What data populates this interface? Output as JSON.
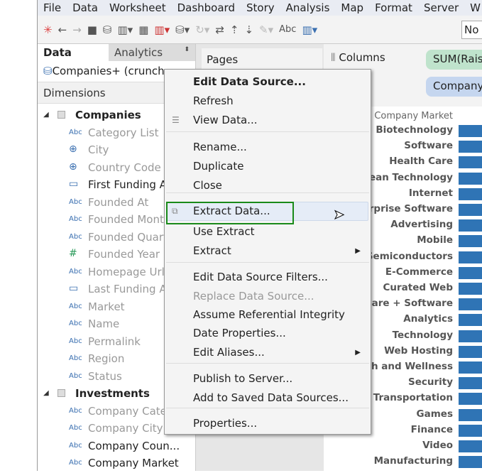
{
  "menubar": [
    "File",
    "Data",
    "Worksheet",
    "Dashboard",
    "Story",
    "Analysis",
    "Map",
    "Format",
    "Server",
    "W"
  ],
  "toolbar": {
    "abc_label": "Abc",
    "dropdown_value": "No"
  },
  "side": {
    "tab_data": "Data",
    "tab_analytics": "Analytics",
    "datasource": "Companies+ (crunch",
    "dimensions_label": "Dimensions",
    "fields": [
      {
        "type": "group",
        "label": "Companies"
      },
      {
        "type": "abc",
        "label": "Category List"
      },
      {
        "type": "geo",
        "label": "City"
      },
      {
        "type": "geo",
        "label": "Country Code"
      },
      {
        "type": "date",
        "label": "First Funding A",
        "dark": true
      },
      {
        "type": "abc",
        "label": "Founded At"
      },
      {
        "type": "abc",
        "label": "Founded Mont"
      },
      {
        "type": "abc",
        "label": "Founded Quart"
      },
      {
        "type": "num",
        "label": "Founded Year"
      },
      {
        "type": "abc",
        "label": "Homepage Url"
      },
      {
        "type": "date",
        "label": "Last Funding A"
      },
      {
        "type": "abc",
        "label": "Market"
      },
      {
        "type": "abc",
        "label": "Name"
      },
      {
        "type": "abc",
        "label": "Permalink"
      },
      {
        "type": "abc",
        "label": "Region"
      },
      {
        "type": "abc",
        "label": "Status"
      },
      {
        "type": "group",
        "label": "Investments"
      },
      {
        "type": "abc",
        "label": "Company Cate"
      },
      {
        "type": "abc",
        "label": "Company City"
      },
      {
        "type": "abc",
        "label": "Company Coun...",
        "dark": true
      },
      {
        "type": "abc",
        "label": "Company Market",
        "dark": true
      }
    ]
  },
  "shelves": {
    "pages": "Pages",
    "columns": "Columns",
    "columns_pill": "SUM(Raise",
    "rows_pill": "Company"
  },
  "chart": {
    "header": "Company Market",
    "categories": [
      "Biotechnology",
      "Software",
      "Health Care",
      "Clean Technology",
      "Internet",
      "Enterprise Software",
      "Advertising",
      "Mobile",
      "Semiconductors",
      "E-Commerce",
      "Curated Web",
      "Hardware + Software",
      "Analytics",
      "Technology",
      "Web Hosting",
      "Health and Wellness",
      "Security",
      "Transportation",
      "Games",
      "Finance",
      "Video",
      "Manufacturing"
    ],
    "bar_color": "#2f74b5"
  },
  "context_menu": {
    "items": [
      {
        "label": "Edit Data Source...",
        "bold": true
      },
      {
        "label": "Refresh"
      },
      {
        "label": "View Data...",
        "icon": "table-icon"
      },
      {
        "label": "Rename..."
      },
      {
        "label": "Duplicate"
      },
      {
        "label": "Close"
      },
      {
        "label": "Extract Data...",
        "icon": "extract-icon",
        "highlighted": true
      },
      {
        "label": "Use Extract"
      },
      {
        "label": "Extract",
        "submenu": true
      },
      {
        "label": "Edit Data Source Filters..."
      },
      {
        "label": "Replace Data Source...",
        "disabled": true
      },
      {
        "label": "Assume Referential Integrity"
      },
      {
        "label": "Date Properties..."
      },
      {
        "label": "Edit Aliases...",
        "submenu": true
      },
      {
        "label": "Publish to Server..."
      },
      {
        "label": "Add to Saved Data Sources..."
      },
      {
        "label": "Properties..."
      }
    ]
  }
}
